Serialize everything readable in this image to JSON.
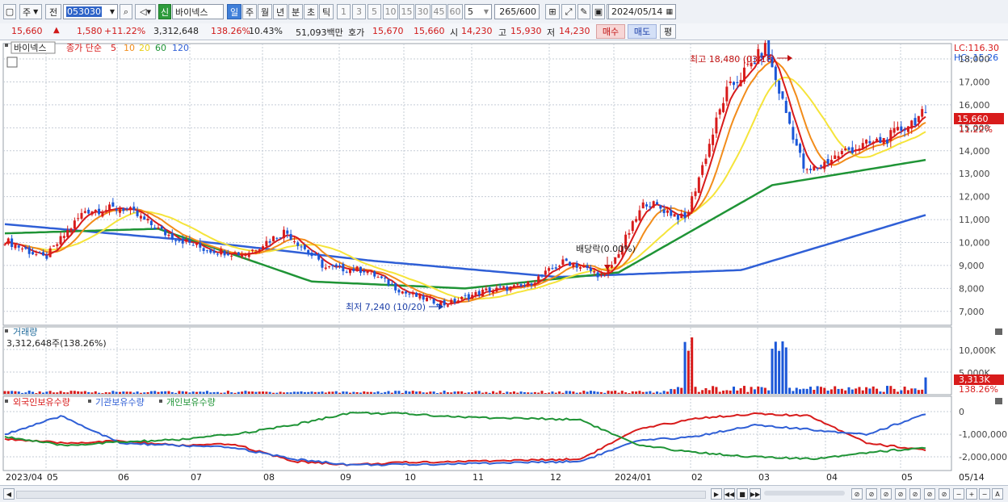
{
  "toolbar": {
    "market_type": "주",
    "prev_label": "전",
    "stock_code": "053030",
    "credit_badge": "신",
    "stock_name": "바이넥스",
    "periods": [
      "일",
      "주",
      "월",
      "년",
      "분",
      "초",
      "틱"
    ],
    "active_period": "일",
    "intervals": [
      "1",
      "3",
      "5",
      "10",
      "15",
      "30",
      "45",
      "60"
    ],
    "interval_value": "5",
    "count_value": "265",
    "count_total": "/600",
    "date_value": "2024/05/14"
  },
  "quote": {
    "price": "15,660",
    "arrow": "▲",
    "change": "1,580",
    "change_rate": "+11.22%",
    "volume": "3,312,648",
    "volume_ratio": "138.26%",
    "turnover": "10.43%",
    "trade_amount": "51,093백만",
    "ask_label": "호가",
    "ask": "15,670",
    "bid": "15,660",
    "open_label": "시",
    "open": "14,230",
    "high_label": "고",
    "high": "15,930",
    "low_label": "저",
    "low": "14,230",
    "buy_label": "매수",
    "sell_label": "매도",
    "eval_label": "평"
  },
  "legend": {
    "name": "바이넥스",
    "price_label": "종가 단순",
    "ma_periods": [
      "5",
      "10",
      "20",
      "60",
      "120"
    ]
  },
  "colors": {
    "up": "#d81b1b",
    "down": "#1b57d8",
    "ma5": "#d81b1b",
    "ma10": "#f28c1a",
    "ma20": "#f5e43a",
    "ma60": "#1f9436",
    "ma120": "#2f5fd6",
    "foreign": "#d81b1b",
    "institution": "#2f5fd6",
    "individual": "#1f9436"
  },
  "price_axis": {
    "lc": "LC:116.30",
    "hc": "HC:-15.26",
    "ticks": [
      "18,000",
      "17,000",
      "16,000",
      "15,000",
      "14,000",
      "13,000",
      "12,000",
      "11,000",
      "10,000",
      "9,000",
      "8,000",
      "7,000"
    ],
    "current": "15,660",
    "current_rate": "11.22%"
  },
  "annotations": {
    "high": "최고 18,480 (03/18)",
    "low": "최저 7,240 (10/20)",
    "dividend": "배당락(0.00%)"
  },
  "volume_panel": {
    "title": "거래량",
    "value": "3,312,648주(138.26%)",
    "ticks": [
      "10,000K",
      "5,000K"
    ],
    "current": "3,313K",
    "current_rate": "138.26%"
  },
  "holder_panel": {
    "series_names": [
      "외국인보유수량",
      "기관보유수량",
      "개인보유수량"
    ],
    "ticks": [
      "0",
      "-1,000,000",
      "-2,000,000"
    ]
  },
  "x_axis": {
    "labels": [
      "2023/04",
      "05",
      "06",
      "07",
      "08",
      "09",
      "10",
      "11",
      "12",
      "2024/01",
      "02",
      "03",
      "04",
      "05",
      "05/14"
    ]
  },
  "chart_data": {
    "type": "candlestick",
    "ylim": [
      6500,
      18600
    ],
    "close_series": [
      {
        "x": "2023/04",
        "y": 10100
      },
      {
        "x": "2023/05",
        "y": 9300
      },
      {
        "x": "2023/05 mid",
        "y": 11400
      },
      {
        "x": "2023/06",
        "y": 11500
      },
      {
        "x": "2023/06 end",
        "y": 10400
      },
      {
        "x": "2023/07",
        "y": 9700
      },
      {
        "x": "2023/07 end",
        "y": 9500
      },
      {
        "x": "2023/08",
        "y": 10500
      },
      {
        "x": "2023/08 end",
        "y": 8900
      },
      {
        "x": "2023/09",
        "y": 8800
      },
      {
        "x": "2023/09 end",
        "y": 7800
      },
      {
        "x": "2023/10",
        "y": 7300
      },
      {
        "x": "2023/11",
        "y": 7900
      },
      {
        "x": "2023/12",
        "y": 8100
      },
      {
        "x": "2023/12 end",
        "y": 9200
      },
      {
        "x": "2024/01",
        "y": 8500
      },
      {
        "x": "2024/02",
        "y": 11800
      },
      {
        "x": "2024/02 end",
        "y": 11000
      },
      {
        "x": "2024/03",
        "y": 16500
      },
      {
        "x": "2024/03/18",
        "y": 18480
      },
      {
        "x": "2024/04",
        "y": 13000
      },
      {
        "x": "2024/04 end",
        "y": 14000
      },
      {
        "x": "2024/05",
        "y": 14500
      },
      {
        "x": "2024/05/14",
        "y": 15660
      }
    ],
    "ma60": [
      {
        "x": "2023/04",
        "y": 10400
      },
      {
        "x": "2023/07",
        "y": 10600
      },
      {
        "x": "2023/10",
        "y": 8300
      },
      {
        "x": "2024/01",
        "y": 8000
      },
      {
        "x": "2024/02",
        "y": 8700
      },
      {
        "x": "2024/04",
        "y": 12500
      },
      {
        "x": "2024/05/14",
        "y": 13600
      }
    ],
    "ma120": [
      {
        "x": "2023/04",
        "y": 10800
      },
      {
        "x": "2023/08",
        "y": 10100
      },
      {
        "x": "2023/10",
        "y": 9200
      },
      {
        "x": "2024/01",
        "y": 8500
      },
      {
        "x": "2024/03",
        "y": 8800
      },
      {
        "x": "2024/05/14",
        "y": 11200
      }
    ],
    "volume_units": "K",
    "volume_ylim": [
      0,
      13000
    ],
    "volume_peaks": [
      {
        "x": "2024/02",
        "y": 12500
      },
      {
        "x": "2024/03",
        "y": 11200
      },
      {
        "x": "2024/05/14",
        "y": 3313
      }
    ],
    "holder_ylim": [
      -2500000,
      500000
    ]
  }
}
